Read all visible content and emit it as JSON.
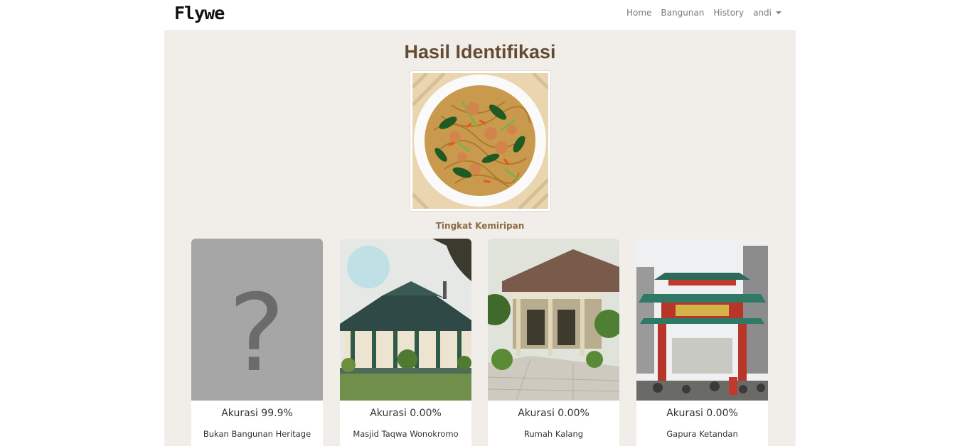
{
  "brand": "Flywe",
  "nav": {
    "home": "Home",
    "bangunan": "Bangunan",
    "history": "History",
    "user": "andi"
  },
  "page": {
    "title": "Hasil Identifikasi",
    "similarity_label": "Tingkat Kemiripan"
  },
  "results": [
    {
      "accuracy": "Akurasi 99.9%",
      "name": "Bukan Bangunan Heritage",
      "icon": "question-mark-icon"
    },
    {
      "accuracy": "Akurasi 0.00%",
      "name": "Masjid Taqwa Wonokromo"
    },
    {
      "accuracy": "Akurasi 0.00%",
      "name": "Rumah Kalang"
    },
    {
      "accuracy": "Akurasi 0.00%",
      "name": "Gapura Ketandan"
    }
  ],
  "colors": {
    "title": "#664b33",
    "subtitle": "#8c6a44",
    "background": "#f1eeea"
  }
}
